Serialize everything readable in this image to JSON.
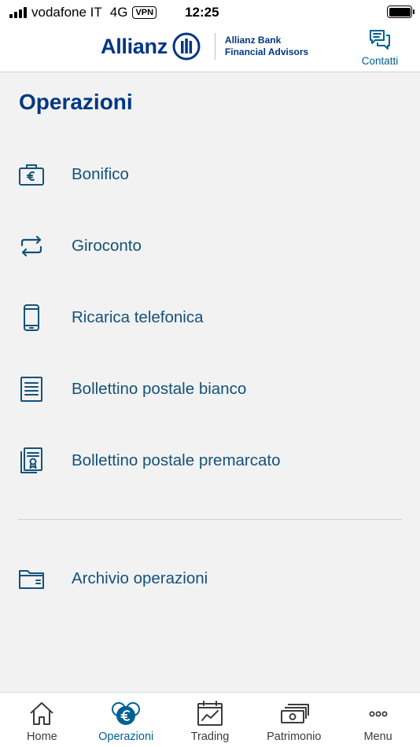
{
  "status_bar": {
    "carrier": "vodafone IT",
    "network": "4G",
    "vpn": "VPN",
    "time": "12:25"
  },
  "header": {
    "brand": "Allianz",
    "sub_brand_line1": "Allianz Bank",
    "sub_brand_line2": "Financial Advisors",
    "contacts_label": "Contatti",
    "contacts_icon": "chat-bubbles-icon"
  },
  "main": {
    "title": "Operazioni",
    "items": [
      {
        "label": "Bonifico",
        "icon": "euro-wallet-icon"
      },
      {
        "label": "Giroconto",
        "icon": "transfer-arrows-icon"
      },
      {
        "label": "Ricarica telefonica",
        "icon": "phone-icon"
      },
      {
        "label": "Bollettino postale bianco",
        "icon": "document-icon"
      },
      {
        "label": "Bollettino postale premarcato",
        "icon": "certificate-icon"
      }
    ],
    "archive": {
      "label": "Archivio operazioni",
      "icon": "folder-icon"
    }
  },
  "tab_bar": {
    "tabs": [
      {
        "label": "Home",
        "icon": "home-icon",
        "active": false
      },
      {
        "label": "Operazioni",
        "icon": "euro-coins-icon",
        "active": true
      },
      {
        "label": "Trading",
        "icon": "trading-chart-icon",
        "active": false
      },
      {
        "label": "Patrimonio",
        "icon": "banknotes-icon",
        "active": false
      },
      {
        "label": "Menu",
        "icon": "more-dots-icon",
        "active": false
      }
    ]
  },
  "colors": {
    "brand_blue": "#003781",
    "accent_blue": "#006192",
    "text_blue": "#13527a",
    "background": "#f2f2f2"
  }
}
